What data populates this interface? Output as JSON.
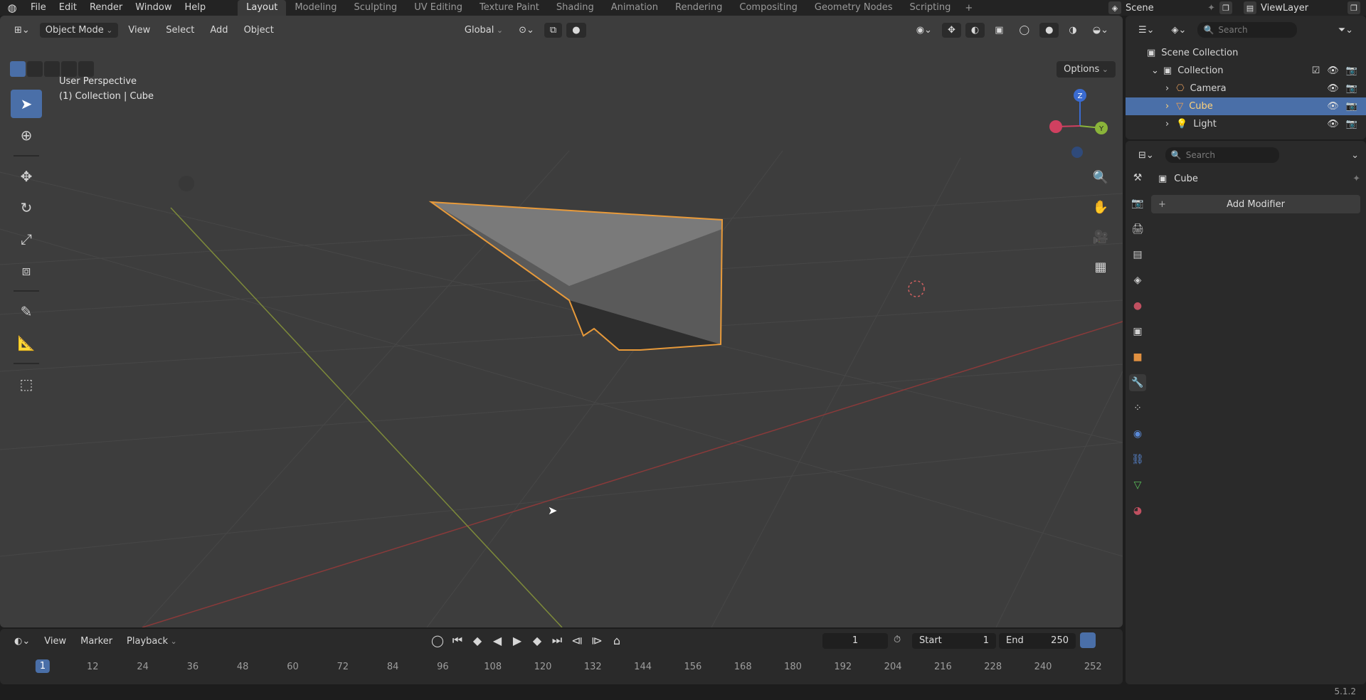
{
  "topbar": {
    "menus": [
      "File",
      "Edit",
      "Render",
      "Window",
      "Help"
    ],
    "workspaces": [
      "Layout",
      "Modeling",
      "Sculpting",
      "UV Editing",
      "Texture Paint",
      "Shading",
      "Animation",
      "Rendering",
      "Compositing",
      "Geometry Nodes",
      "Scripting"
    ],
    "active_workspace": "Layout",
    "add_workspace": "+",
    "scene": "Scene",
    "view_layer": "ViewLayer"
  },
  "viewport": {
    "mode": "Object Mode",
    "menus": [
      "View",
      "Select",
      "Add",
      "Object"
    ],
    "orientation": "Global",
    "options_label": "Options",
    "info_line1": "User Perspective",
    "info_line2": "(1) Collection | Cube",
    "gizmo_axes": {
      "x": "X",
      "y": "Y",
      "z": "Z"
    },
    "colors": {
      "background": "#3d3d3d",
      "grid": "#4a4a4a",
      "x_axis": "#8a3a3a",
      "y_axis": "#7d8a3a",
      "selection_outline": "#e89a3a",
      "active": "#4a6fa8"
    }
  },
  "timeline": {
    "menus": [
      "View",
      "Marker",
      "Playback"
    ],
    "current_frame": "1",
    "start_label": "Start",
    "start_value": "1",
    "end_label": "End",
    "end_value": "250",
    "ticks": [
      "1",
      "12",
      "24",
      "36",
      "48",
      "60",
      "72",
      "84",
      "96",
      "108",
      "120",
      "132",
      "144",
      "156",
      "168",
      "180",
      "192",
      "204",
      "216",
      "228",
      "240",
      "252"
    ]
  },
  "outliner": {
    "search_placeholder": "Search",
    "scene_collection": "Scene Collection",
    "collection": "Collection",
    "items": [
      {
        "name": "Camera",
        "icon": "camera-icon"
      },
      {
        "name": "Cube",
        "icon": "mesh-icon",
        "selected": true
      },
      {
        "name": "Light",
        "icon": "light-icon"
      }
    ]
  },
  "properties": {
    "search_placeholder": "Search",
    "object_name": "Cube",
    "add_modifier": "Add Modifier"
  },
  "status": {
    "version": "5.1.2"
  }
}
